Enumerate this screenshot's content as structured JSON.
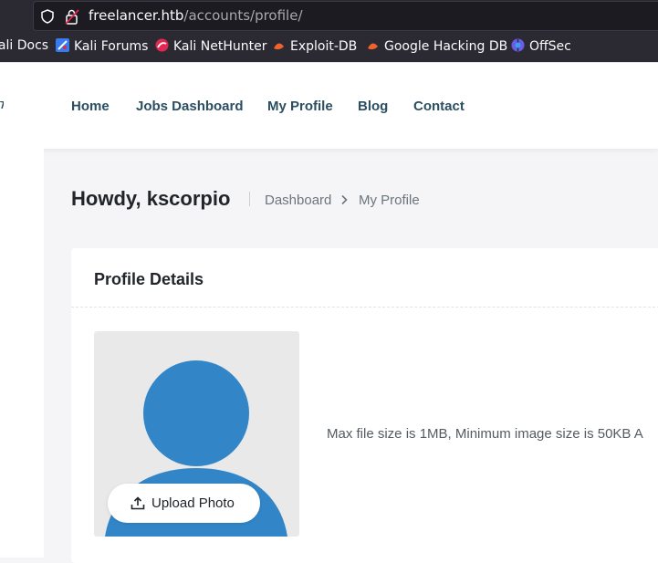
{
  "browser": {
    "url_host": "freelancer.htb",
    "url_path": "/accounts/profile/"
  },
  "bookmarks": [
    {
      "label": "Kali Docs",
      "icon": "kali-docs-icon"
    },
    {
      "label": "Kali Forums",
      "icon": "kali-forums-icon"
    },
    {
      "label": "Kali NetHunter",
      "icon": "kali-nethunter-icon"
    },
    {
      "label": "Exploit-DB",
      "icon": "exploit-db-icon"
    },
    {
      "label": "Google Hacking DB",
      "icon": "ghdb-icon"
    },
    {
      "label": "OffSec",
      "icon": "offsec-icon"
    }
  ],
  "nav": {
    "items": [
      "Home",
      "Jobs Dashboard",
      "My Profile",
      "Blog",
      "Contact"
    ]
  },
  "header": {
    "greeting": "Howdy, kscorpio",
    "breadcrumb": [
      "Dashboard",
      "My Profile"
    ]
  },
  "profile": {
    "title": "Profile Details",
    "upload_label": "Upload Photo",
    "hint": "Max file size is 1MB, Minimum image size is 50KB A"
  },
  "colors": {
    "accent": "#3286c8",
    "nav_text": "#2a4e62",
    "browser_bg": "#2b2a33"
  }
}
